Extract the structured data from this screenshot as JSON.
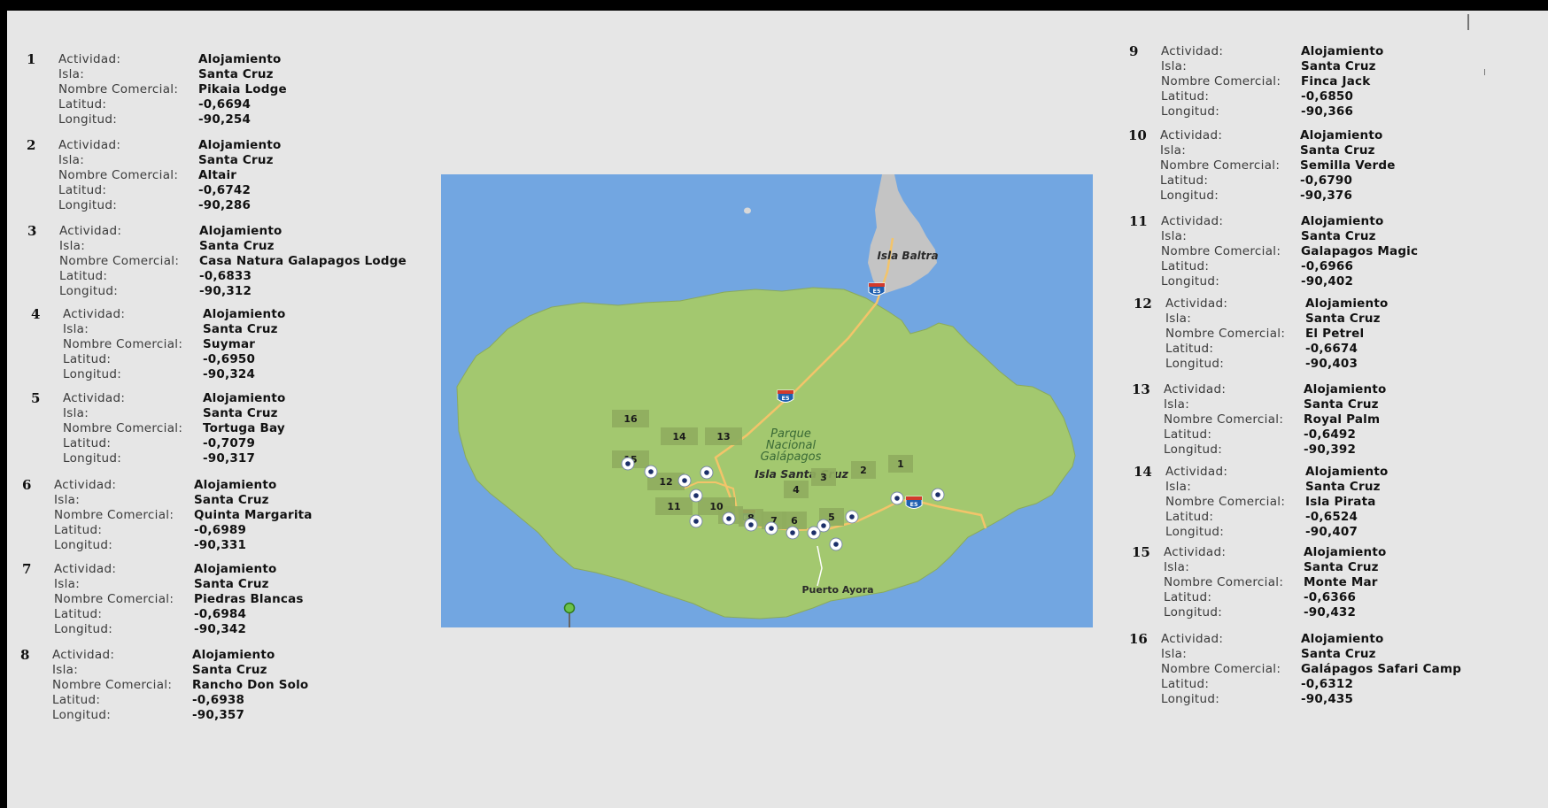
{
  "labels": {
    "actividad": "Actividad:",
    "isla": "Isla:",
    "nombre": "Nombre Comercial:",
    "latitud": "Latitud:",
    "longitud": "Longitud:"
  },
  "places": [
    {
      "num": "1",
      "actividad": "Alojamiento",
      "isla": "Santa Cruz",
      "nombre": "Pikaia Lodge",
      "latitud": "-0,6694",
      "longitud": "-90,254"
    },
    {
      "num": "2",
      "actividad": "Alojamiento",
      "isla": "Santa Cruz",
      "nombre": "Altair",
      "latitud": "-0,6742",
      "longitud": "-90,286"
    },
    {
      "num": "3",
      "actividad": "Alojamiento",
      "isla": "Santa Cruz",
      "nombre": "Casa Natura Galapagos Lodge",
      "latitud": "-0,6833",
      "longitud": "-90,312"
    },
    {
      "num": "4",
      "actividad": "Alojamiento",
      "isla": "Santa Cruz",
      "nombre": "Suymar",
      "latitud": "-0,6950",
      "longitud": "-90,324"
    },
    {
      "num": "5",
      "actividad": "Alojamiento",
      "isla": "Santa Cruz",
      "nombre": "Tortuga Bay",
      "latitud": "-0,7079",
      "longitud": "-90,317"
    },
    {
      "num": "6",
      "actividad": "Alojamiento",
      "isla": "Santa Cruz",
      "nombre": "Quinta Margarita",
      "latitud": "-0,6989",
      "longitud": "-90,331"
    },
    {
      "num": "7",
      "actividad": "Alojamiento",
      "isla": "Santa Cruz",
      "nombre": "Piedras Blancas",
      "latitud": "-0,6984",
      "longitud": "-90,342"
    },
    {
      "num": "8",
      "actividad": "Alojamiento",
      "isla": "Santa Cruz",
      "nombre": "Rancho Don Solo",
      "latitud": "-0,6938",
      "longitud": "-90,357"
    },
    {
      "num": "9",
      "actividad": "Alojamiento",
      "isla": "Santa Cruz",
      "nombre": "Finca Jack",
      "latitud": "-0,6850",
      "longitud": "-90,366"
    },
    {
      "num": "10",
      "actividad": "Alojamiento",
      "isla": "Santa Cruz",
      "nombre": "Semilla Verde",
      "latitud": "-0,6790",
      "longitud": "-90,376"
    },
    {
      "num": "11",
      "actividad": "Alojamiento",
      "isla": "Santa Cruz",
      "nombre": "Galapagos Magic",
      "latitud": "-0,6966",
      "longitud": "-90,402"
    },
    {
      "num": "12",
      "actividad": "Alojamiento",
      "isla": "Santa Cruz",
      "nombre": "El Petrel",
      "latitud": "-0,6674",
      "longitud": "-90,403"
    },
    {
      "num": "13",
      "actividad": "Alojamiento",
      "isla": "Santa Cruz",
      "nombre": "Royal Palm",
      "latitud": "-0,6492",
      "longitud": "-90,392"
    },
    {
      "num": "14",
      "actividad": "Alojamiento",
      "isla": "Santa Cruz",
      "nombre": "Isla Pirata",
      "latitud": "-0,6524",
      "longitud": "-90,407"
    },
    {
      "num": "15",
      "actividad": "Alojamiento",
      "isla": "Santa Cruz",
      "nombre": "Monte Mar",
      "latitud": "-0,6366",
      "longitud": "-90,432"
    },
    {
      "num": "16",
      "actividad": "Alojamiento",
      "isla": "Santa Cruz",
      "nombre": "Galápagos Safari Camp",
      "latitud": "-0,6312",
      "longitud": "-90,435"
    }
  ],
  "map": {
    "label_baltra": "Isla Baltra",
    "label_parque": [
      "Parque",
      "Nacional",
      "Galápagos"
    ],
    "label_santacruz": "Isla Santa Cruz",
    "label_ayora": "Puerto Ayora",
    "highway_shield": "E5",
    "colors": {
      "water": "#72a6e1",
      "land": "#a3c86f",
      "baltra": "#c4c4c4",
      "road": "#f3c46a",
      "label_box": "#8fac5e",
      "marker": "#ffffff"
    }
  }
}
